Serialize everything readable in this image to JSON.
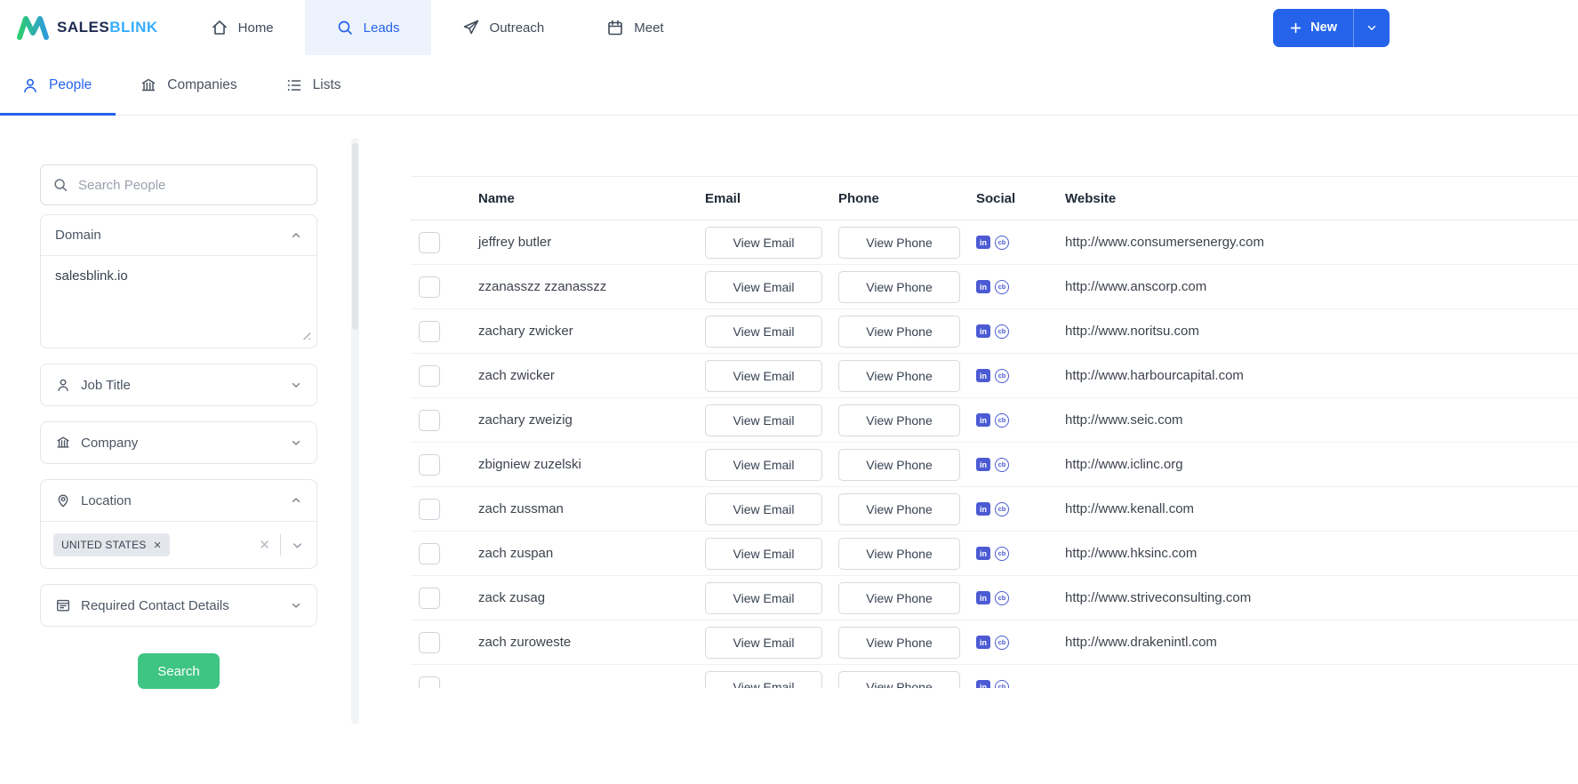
{
  "brand": {
    "sales": "SALES",
    "blink": "BLINK"
  },
  "nav": {
    "items": [
      {
        "label": "Home",
        "active": false
      },
      {
        "label": "Leads",
        "active": true
      },
      {
        "label": "Outreach",
        "active": false
      },
      {
        "label": "Meet",
        "active": false
      }
    ],
    "new_button_label": "New"
  },
  "tabs": [
    {
      "label": "People",
      "active": true
    },
    {
      "label": "Companies",
      "active": false
    },
    {
      "label": "Lists",
      "active": false
    }
  ],
  "sidebar": {
    "search_placeholder": "Search People",
    "panels": {
      "domain": {
        "label": "Domain",
        "value": "salesblink.io",
        "expanded": true
      },
      "job_title": {
        "label": "Job Title",
        "expanded": false
      },
      "company": {
        "label": "Company",
        "expanded": false
      },
      "location": {
        "label": "Location",
        "expanded": true,
        "selected_tag": "UNITED STATES"
      },
      "required_contact": {
        "label": "Required Contact Details",
        "expanded": false
      }
    },
    "search_button_label": "Search"
  },
  "table": {
    "headers": [
      "Name",
      "Email",
      "Phone",
      "Social",
      "Website"
    ],
    "email_button": "View Email",
    "phone_button": "View Phone",
    "social_icons": [
      "linkedin",
      "crunchbase"
    ],
    "rows": [
      {
        "name": "jeffrey butler",
        "website": "http://www.consumersenergy.com"
      },
      {
        "name": "zzanasszz zzanasszz",
        "website": "http://www.anscorp.com"
      },
      {
        "name": "zachary zwicker",
        "website": "http://www.noritsu.com"
      },
      {
        "name": "zach zwicker",
        "website": "http://www.harbourcapital.com"
      },
      {
        "name": "zachary zweizig",
        "website": "http://www.seic.com"
      },
      {
        "name": "zbigniew zuzelski",
        "website": "http://www.iclinc.org"
      },
      {
        "name": "zach zussman",
        "website": "http://www.kenall.com"
      },
      {
        "name": "zach zuspan",
        "website": "http://www.hksinc.com"
      },
      {
        "name": "zack zusag",
        "website": "http://www.striveconsulting.com"
      },
      {
        "name": "zach zuroweste",
        "website": "http://www.drakenintl.com"
      }
    ]
  },
  "colors": {
    "primary_blue": "#2563eb",
    "active_nav_bg": "#edf3fd",
    "search_green": "#3ec483",
    "social_icon": "#4c5bd4",
    "logo_navy": "#1d2b4f",
    "logo_sky": "#39aefc"
  }
}
